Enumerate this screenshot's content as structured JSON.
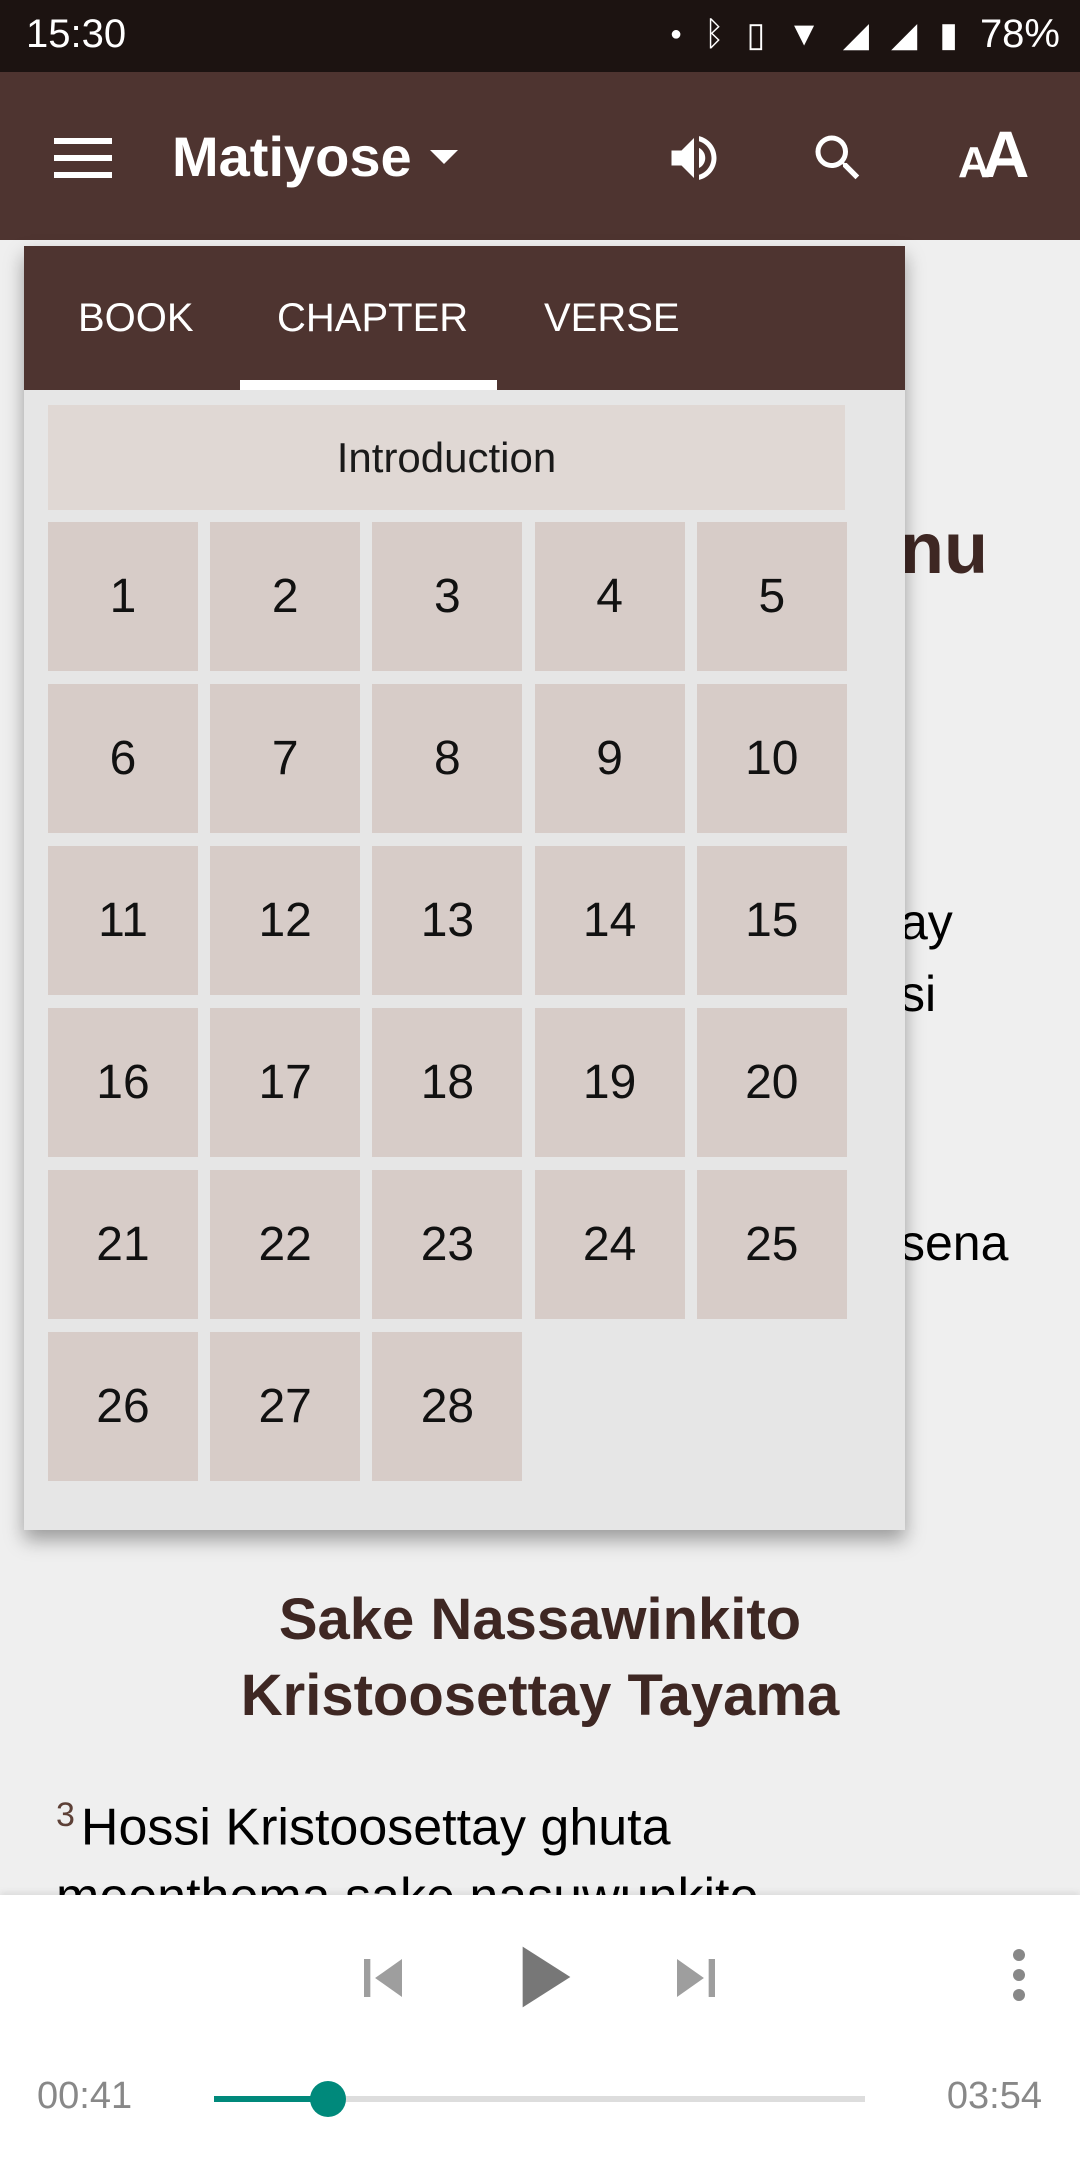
{
  "status_bar": {
    "time": "15:30",
    "battery": "78%",
    "icons": [
      "dot",
      "bluetooth-icon",
      "vibrate-icon",
      "wifi-icon",
      "signal-icon",
      "signal-icon",
      "battery-icon"
    ]
  },
  "app_bar": {
    "title": "Matiyose",
    "icons": [
      "menu-icon",
      "speaker-icon",
      "search-icon",
      "font-size-icon"
    ],
    "font_label": "AA",
    "color": "#4e3430"
  },
  "background_text": {
    "fragments": [
      "nu",
      "ay",
      "si",
      "sena"
    ]
  },
  "chooser": {
    "tabs": [
      {
        "label": "BOOK"
      },
      {
        "label": "CHAPTER",
        "selected": true
      },
      {
        "label": "VERSE"
      }
    ],
    "intro": "Introduction",
    "chapters": [
      "1",
      "2",
      "3",
      "4",
      "5",
      "6",
      "7",
      "8",
      "9",
      "10",
      "11",
      "12",
      "13",
      "14",
      "15",
      "16",
      "17",
      "18",
      "19",
      "20",
      "21",
      "22",
      "23",
      "24",
      "25",
      "26",
      "27",
      "28"
    ]
  },
  "content": {
    "heading_lines": [
      "Sake Nassawinkito",
      "Kristoosettay Tayama"
    ],
    "verse_number": "3",
    "verse_text": "Hossi Kristoosettay ghuta",
    "verse_text_2": "moonthoma sake nasuwunkito"
  },
  "player": {
    "elapsed": "00:41",
    "duration": "03:54",
    "progress": 0.175,
    "accent": "#00897b"
  }
}
